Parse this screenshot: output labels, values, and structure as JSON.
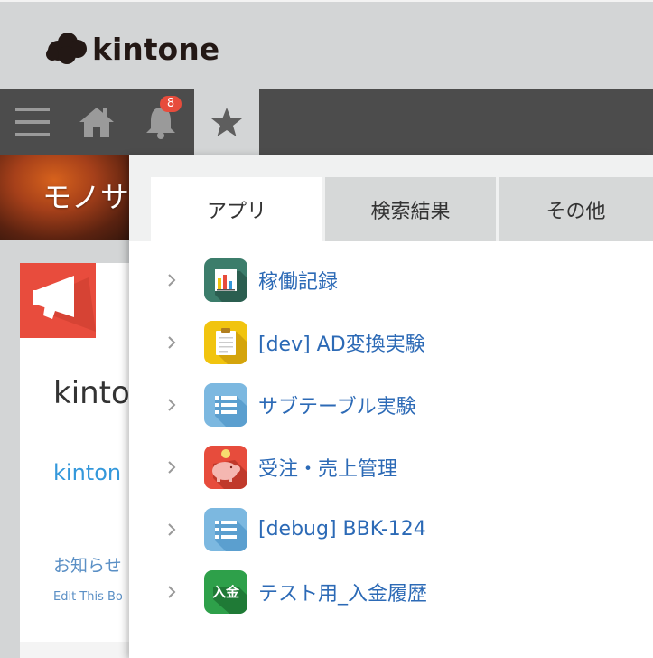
{
  "header": {
    "logo_text": "kintone"
  },
  "nav": {
    "notification_count": "8",
    "icons": [
      "menu-icon",
      "home-icon",
      "bell-icon",
      "star-icon"
    ]
  },
  "background": {
    "hero_title": "モノサ",
    "card_heading": "kinto",
    "card_link": "kinton",
    "card_notice": "お知らせ",
    "card_edit": "Edit This Bo"
  },
  "favorites": {
    "tabs": [
      {
        "label": "アプリ",
        "active": true
      },
      {
        "label": "検索結果",
        "active": false
      },
      {
        "label": "その他",
        "active": false
      }
    ],
    "apps": [
      {
        "name": "稼働記録",
        "icon": "bar-chart-icon",
        "color": "#3c7d6b"
      },
      {
        "name": "[dev] AD変換実験",
        "icon": "clipboard-icon",
        "color": "#f1c40f"
      },
      {
        "name": "サブテーブル実験",
        "icon": "list-icon",
        "color": "#7cb8e0"
      },
      {
        "name": "受注・売上管理",
        "icon": "piggy-bank-icon",
        "color": "#e74c3c"
      },
      {
        "name": "[debug] BBK-124",
        "icon": "list-icon",
        "color": "#7cb8e0"
      },
      {
        "name": "テスト用_入金履歴",
        "icon": "deposit-icon",
        "icon_text": "入金",
        "color": "#2ea04a"
      }
    ]
  }
}
